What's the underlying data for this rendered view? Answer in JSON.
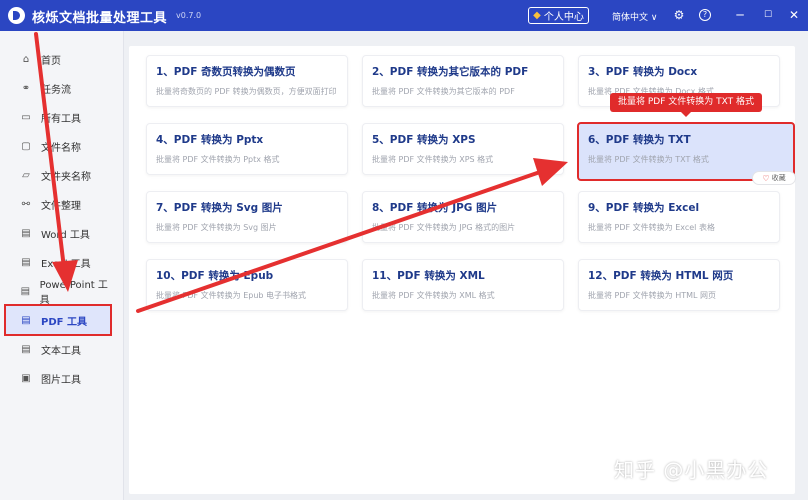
{
  "app": {
    "title": "核烁文档批量处理工具",
    "version": "v0.7.0",
    "user_center_label": "个人中心",
    "language": "简体中文 ∨",
    "accent_color": "#2b46c2",
    "highlight_color": "#e02b2b"
  },
  "sidebar": {
    "items": [
      {
        "label": "首页",
        "icon": "home-icon",
        "glyph": "⌂"
      },
      {
        "label": "任务流",
        "icon": "workflow-icon",
        "glyph": "⚭"
      },
      {
        "label": "所有工具",
        "icon": "monitor-icon",
        "glyph": "▭"
      },
      {
        "label": "文件名称",
        "icon": "file-name-icon",
        "glyph": "▢"
      },
      {
        "label": "文件夹名称",
        "icon": "folder-icon",
        "glyph": "▱"
      },
      {
        "label": "文件整理",
        "icon": "organize-icon",
        "glyph": "⚯"
      },
      {
        "label": "Word 工具",
        "icon": "word-icon",
        "glyph": "▤"
      },
      {
        "label": "Excel 工具",
        "icon": "excel-icon",
        "glyph": "▤"
      },
      {
        "label": "PowerPoint 工具",
        "icon": "powerpoint-icon",
        "glyph": "▤"
      },
      {
        "label": "PDF 工具",
        "icon": "pdf-icon",
        "glyph": "▤"
      },
      {
        "label": "文本工具",
        "icon": "text-icon",
        "glyph": "▤"
      },
      {
        "label": "图片工具",
        "icon": "image-icon",
        "glyph": "▣"
      }
    ]
  },
  "cards": [
    {
      "title": "1、PDF 奇数页转换为偶数页",
      "desc": "批量将奇数页的 PDF 转换为偶数页，方便双面打印"
    },
    {
      "title": "2、PDF 转换为其它版本的 PDF",
      "desc": "批量将 PDF 文件转换为其它版本的 PDF"
    },
    {
      "title": "3、PDF 转换为 Docx",
      "desc": "批量将 PDF 文件转换为 Docx 格式"
    },
    {
      "title": "4、PDF 转换为 Pptx",
      "desc": "批量将 PDF 文件转换为 Pptx 格式"
    },
    {
      "title": "5、PDF 转换为 XPS",
      "desc": "批量将 PDF 文件转换为 XPS 格式"
    },
    {
      "title": "6、PDF 转换为 TXT",
      "desc": "批量将 PDF 文件转换为 TXT 格式"
    },
    {
      "title": "7、PDF 转换为 Svg 图片",
      "desc": "批量将 PDF 文件转换为 Svg 图片"
    },
    {
      "title": "8、PDF 转换为 JPG 图片",
      "desc": "批量将 PDF 文件转换为 JPG 格式的图片"
    },
    {
      "title": "9、PDF 转换为 Excel",
      "desc": "批量将 PDF 文件转换为 Excel 表格"
    },
    {
      "title": "10、PDF 转换为 Epub",
      "desc": "批量将 PDF 文件转换为 Epub 电子书格式"
    },
    {
      "title": "11、PDF 转换为 XML",
      "desc": "批量将 PDF 文件转换为 XML 格式"
    },
    {
      "title": "12、PDF 转换为 HTML 网页",
      "desc": "批量将 PDF 文件转换为 HTML 网页"
    }
  ],
  "tooltip": "批量将 PDF 文件转换为 TXT 格式",
  "favorite_label": "收藏",
  "watermark": "知乎 @小黑办公"
}
